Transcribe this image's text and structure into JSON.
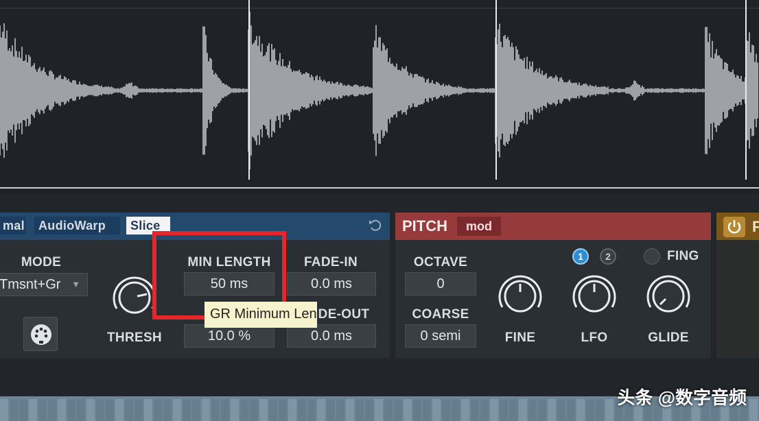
{
  "slice_panel": {
    "tabs": [
      {
        "label": "mal",
        "active": false
      },
      {
        "label": "AudioWarp",
        "active": false
      },
      {
        "label": "Slice",
        "active": true
      }
    ],
    "mode": {
      "label": "MODE",
      "value": "Tmsnt+Gr"
    },
    "thresh": {
      "label": "THRESH"
    },
    "min_length": {
      "label": "MIN LENGTH",
      "value": "50 ms"
    },
    "gr_value": "10.0 %",
    "fade_in": {
      "label": "FADE-IN",
      "value": "0.0 ms"
    },
    "fade_out": {
      "label": "DE-OUT",
      "value": "0.0 ms"
    },
    "tooltip": "GR Minimum Length"
  },
  "pitch_panel": {
    "title": "PITCH",
    "mod_label": "mod",
    "octave": {
      "label": "OCTAVE",
      "value": "0"
    },
    "coarse": {
      "label": "COARSE",
      "value": "0 semi"
    },
    "fine_label": "FINE",
    "lfo_label": "LFO",
    "lfo_buttons": [
      "1",
      "2"
    ],
    "glide_label": "GLIDE",
    "fing_label": "FING"
  },
  "amp_panel": {
    "title": "F"
  },
  "watermark": "头条 @数字音频",
  "colors": {
    "slice_header": "#23496d",
    "pitch_header": "#973a3b",
    "amp_header": "#7a5618",
    "highlight": "#e5262a",
    "tooltip_bg": "#f7f3cc"
  },
  "icons": [
    "undo-icon",
    "dropdown-arrow-icon",
    "midi-icon",
    "power-icon"
  ]
}
